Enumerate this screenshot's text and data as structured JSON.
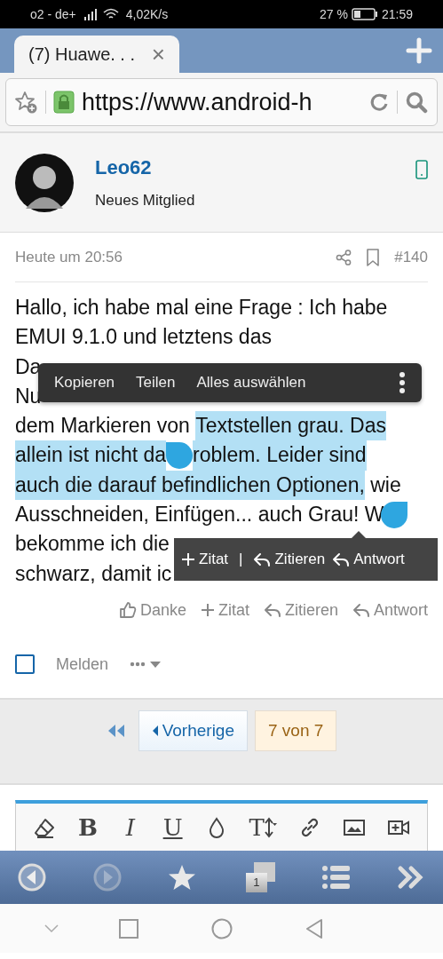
{
  "status_bar": {
    "carrier": "o2 - de+",
    "speed": "4,02K/s",
    "battery": "27 %",
    "time": "21:59"
  },
  "browser_tab": {
    "title": "(7) Huawe. . .",
    "close": "×"
  },
  "address_bar": {
    "url": "https://www.android-h"
  },
  "author": {
    "name": "Leo62",
    "rank": "Neues Mitglied"
  },
  "post": {
    "date": "Heute um 20:56",
    "number": "#140",
    "lines": [
      [
        {
          "kind": "text",
          "text": "Hallo, ich habe mal eine Frage : Ich habe",
          "selected": false
        }
      ],
      [
        {
          "kind": "text",
          "text": "EMUI 9.1.0 und letztens das",
          "selected": false
        }
      ],
      [
        {
          "kind": "text",
          "text": "Da",
          "selected": false
        }
      ],
      [
        {
          "kind": "text",
          "text": "Nu",
          "selected": false
        }
      ],
      [
        {
          "kind": "text",
          "text": "dem Markieren von ",
          "selected": false
        },
        {
          "kind": "text",
          "text": "Textstellen grau. Das",
          "selected": true
        }
      ],
      [
        {
          "kind": "text",
          "text": "allein ist nicht da",
          "selected": true
        },
        {
          "kind": "handle",
          "selected": true
        },
        {
          "kind": "text",
          "text": "roblem. Leider sind",
          "selected": true
        }
      ],
      [
        {
          "kind": "text",
          "text": "auch die darauf befindlichen Optionen,",
          "selected": true
        },
        {
          "kind": "text",
          "text": " wie",
          "selected": false
        }
      ],
      [
        {
          "kind": "text",
          "text": "Ausschneiden, Einfügen... auch Grau! W",
          "selected": false
        },
        {
          "kind": "handle",
          "selected": false
        }
      ],
      [
        {
          "kind": "text",
          "text": "bekomme ich die",
          "selected": false
        }
      ],
      [
        {
          "kind": "text",
          "text": "schwarz, damit ic",
          "selected": false
        }
      ]
    ],
    "actions": [
      {
        "kind": "thanks",
        "label": "Danke"
      },
      {
        "kind": "plus",
        "label": "Zitat"
      },
      {
        "kind": "reply",
        "label": "Zitieren"
      },
      {
        "kind": "reply",
        "label": "Antwort"
      }
    ],
    "select_checkbox": {
      "checked": false
    },
    "report": "Melden"
  },
  "context_menu": {
    "items": [
      "Kopieren",
      "Teilen",
      "Alles auswählen"
    ]
  },
  "quote_popup": {
    "items": [
      {
        "kind": "plus",
        "label": "Zitat"
      },
      {
        "kind": "separator",
        "label": "|"
      },
      {
        "kind": "reply",
        "label": "Zitieren"
      },
      {
        "kind": "reply",
        "label": "Antwort"
      }
    ]
  },
  "pagination": {
    "previous": "Vorherige",
    "current": "7 von 7"
  },
  "editor_toolbar": [
    {
      "kind": "eraser"
    },
    {
      "kind": "bold",
      "label": "B"
    },
    {
      "kind": "italic",
      "label": "I"
    },
    {
      "kind": "underline",
      "label": "U"
    },
    {
      "kind": "drop"
    },
    {
      "kind": "size",
      "label": "T"
    },
    {
      "kind": "link"
    },
    {
      "kind": "image"
    },
    {
      "kind": "video"
    }
  ],
  "browser_toolbar": [
    {
      "kind": "back",
      "disabled": false
    },
    {
      "kind": "forward",
      "disabled": true
    },
    {
      "kind": "star",
      "disabled": false
    },
    {
      "kind": "tabs",
      "label": "1",
      "disabled": false
    },
    {
      "kind": "list",
      "disabled": false
    },
    {
      "kind": "more",
      "disabled": false
    }
  ]
}
